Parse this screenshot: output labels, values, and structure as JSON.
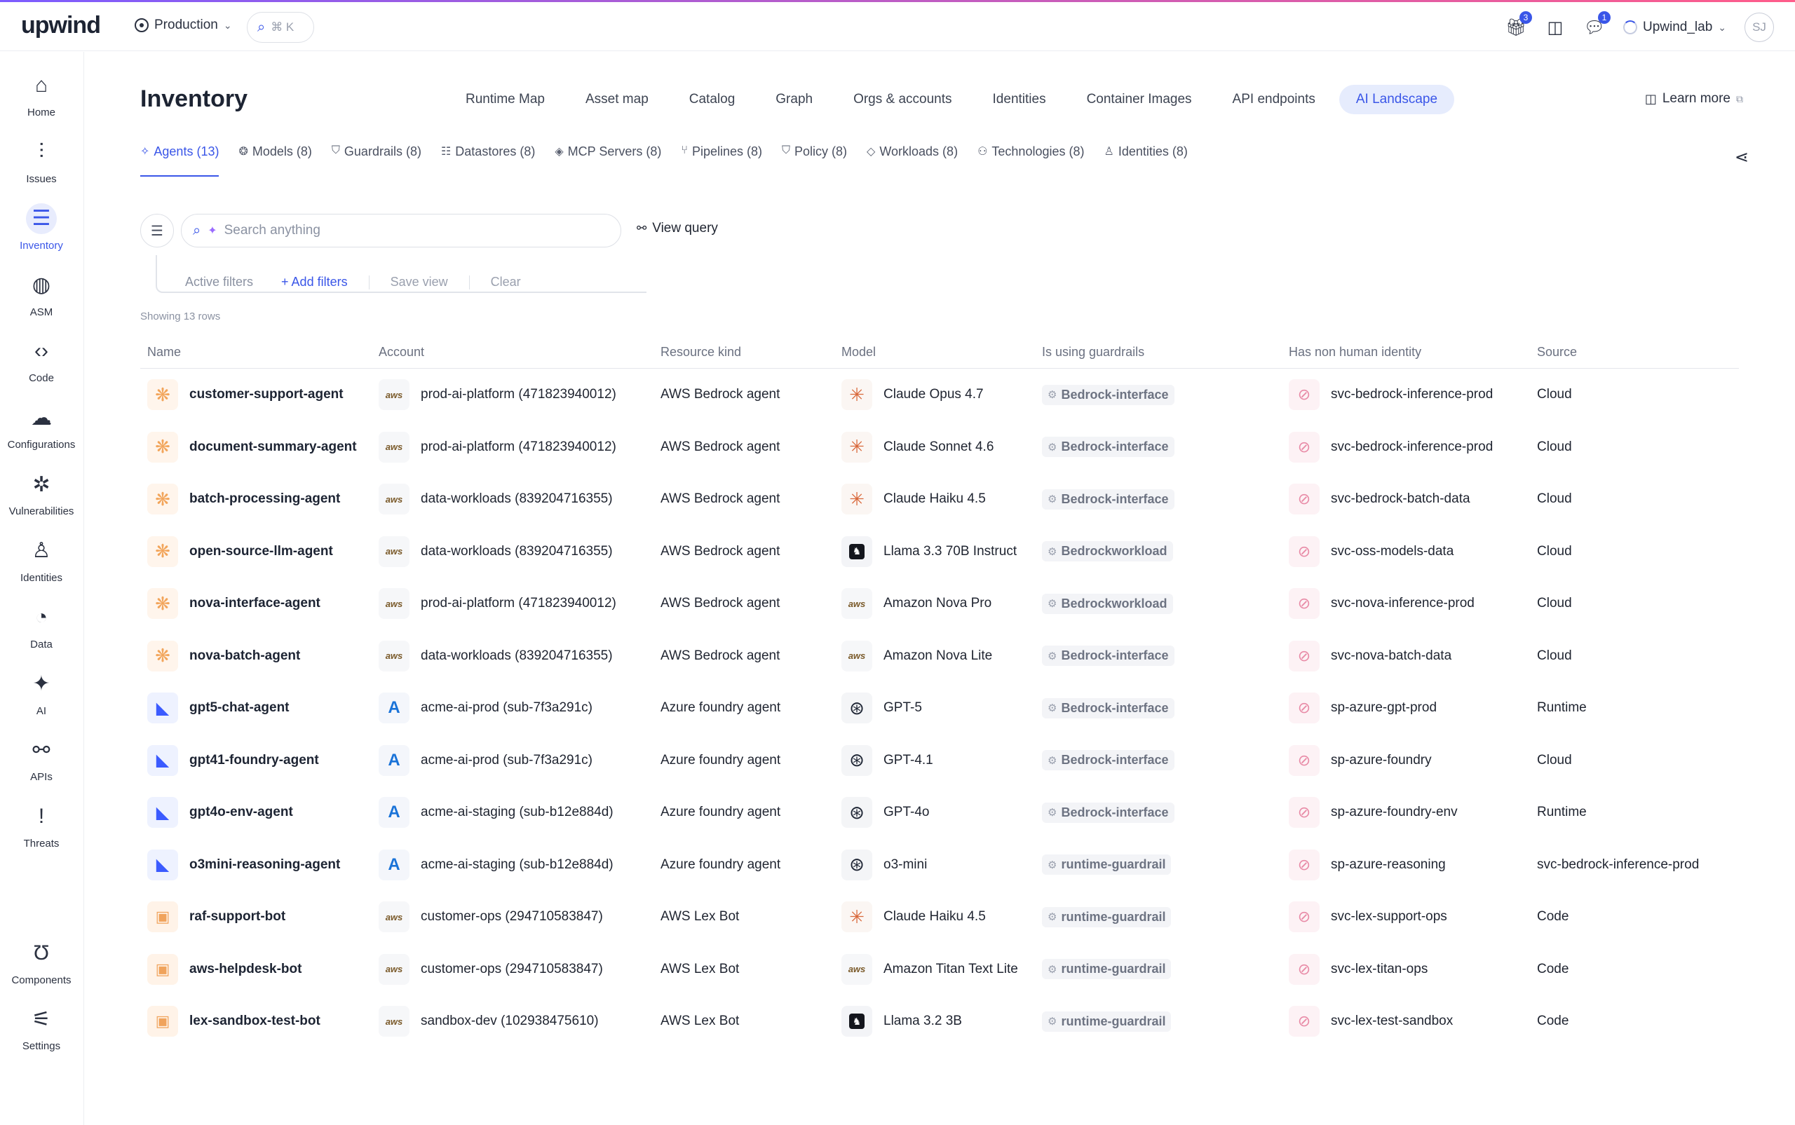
{
  "app": {
    "logo": "upwind",
    "environment": "Production",
    "command_hint": "⌘ K",
    "gift_badge": "3",
    "chat_badge": "1",
    "org_name": "Upwind_lab",
    "avatar_initials": "SJ"
  },
  "sidebar": {
    "items": [
      {
        "label": "Home",
        "icon": "home-icon",
        "glyph": "⌂"
      },
      {
        "label": "Issues",
        "icon": "issues-icon",
        "glyph": "⫶"
      },
      {
        "label": "Inventory",
        "icon": "inventory-icon",
        "glyph": "☰",
        "active": true
      },
      {
        "label": "ASM",
        "icon": "globe-icon",
        "glyph": "◍"
      },
      {
        "label": "Code",
        "icon": "code-icon",
        "glyph": "‹›"
      },
      {
        "label": "Configurations",
        "icon": "cloud-icon",
        "glyph": "☁"
      },
      {
        "label": "Vulnerabilities",
        "icon": "bug-icon",
        "glyph": "✲"
      },
      {
        "label": "Identities",
        "icon": "person-icon",
        "glyph": "♙"
      },
      {
        "label": "Data",
        "icon": "pie-chart-icon",
        "glyph": "◔"
      },
      {
        "label": "AI",
        "icon": "sparkle-icon",
        "glyph": "✦"
      },
      {
        "label": "APIs",
        "icon": "share-nodes-icon",
        "glyph": "⚯"
      },
      {
        "label": "Threats",
        "icon": "exclamation-icon",
        "glyph": "!"
      }
    ],
    "bottom_items": [
      {
        "label": "Components",
        "icon": "components-icon",
        "glyph": "Ʊ"
      },
      {
        "label": "Settings",
        "icon": "sliders-icon",
        "glyph": "⚟"
      }
    ]
  },
  "header": {
    "title": "Inventory",
    "tabs": [
      "Runtime Map",
      "Asset map",
      "Catalog",
      "Graph",
      "Orgs & accounts",
      "Identities",
      "Container Images",
      "API endpoints",
      "AI Landscape"
    ],
    "active_tab": "AI Landscape",
    "learn_more": "Learn more"
  },
  "subtabs": [
    {
      "label": "Agents (13)",
      "icon": "agents-icon",
      "glyph": "✧",
      "active": true
    },
    {
      "label": "Models (8)",
      "icon": "models-icon",
      "glyph": "❂"
    },
    {
      "label": "Guardrails (8)",
      "icon": "shield-icon",
      "glyph": "⛉"
    },
    {
      "label": "Datastores (8)",
      "icon": "database-icon",
      "glyph": "☷"
    },
    {
      "label": "MCP Servers (8)",
      "icon": "mcp-icon",
      "glyph": "◈"
    },
    {
      "label": "Pipelines (8)",
      "icon": "pipeline-icon",
      "glyph": "⑂"
    },
    {
      "label": "Policy (8)",
      "icon": "policy-icon",
      "glyph": "⛉"
    },
    {
      "label": "Workloads (8)",
      "icon": "layers-icon",
      "glyph": "◇"
    },
    {
      "label": "Technologies (8)",
      "icon": "technologies-icon",
      "glyph": "⚇"
    },
    {
      "label": "Identities (8)",
      "icon": "user-icon",
      "glyph": "♙"
    }
  ],
  "filters": {
    "search_placeholder": "Search anything",
    "view_query": "View query",
    "active_filters": "Active filters",
    "add_filters": "+ Add filters",
    "save_view": "Save view",
    "clear": "Clear",
    "showing": "Showing 13 rows"
  },
  "table": {
    "columns": [
      "Name",
      "Account",
      "Resource kind",
      "Model",
      "Is using guardrails",
      "Has non human identity",
      "Source"
    ],
    "rows": [
      {
        "name": "customer-support-agent",
        "name_icon": "bedrock",
        "account": "prod-ai-platform (471823940012)",
        "account_icon": "aws",
        "kind": "AWS Bedrock agent",
        "model": "Claude Opus 4.7",
        "model_icon": "claude",
        "guardrail": "Bedrock-interface",
        "nhi": "svc-bedrock-inference-prod",
        "source": "Cloud"
      },
      {
        "name": "document-summary-agent",
        "name_icon": "bedrock",
        "account": "prod-ai-platform (471823940012)",
        "account_icon": "aws",
        "kind": "AWS Bedrock agent",
        "model": "Claude Sonnet 4.6",
        "model_icon": "claude",
        "guardrail": "Bedrock-interface",
        "nhi": "svc-bedrock-inference-prod",
        "source": "Cloud"
      },
      {
        "name": "batch-processing-agent",
        "name_icon": "bedrock",
        "account": "data-workloads (839204716355)",
        "account_icon": "aws",
        "kind": "AWS Bedrock agent",
        "model": "Claude Haiku 4.5",
        "model_icon": "claude",
        "guardrail": "Bedrock-interface",
        "nhi": "svc-bedrock-batch-data",
        "source": "Cloud"
      },
      {
        "name": "open-source-llm-agent",
        "name_icon": "bedrock",
        "account": "data-workloads (839204716355)",
        "account_icon": "aws",
        "kind": "AWS Bedrock agent",
        "model": "Llama 3.3 70B Instruct",
        "model_icon": "llama",
        "guardrail": "Bedrockworkload",
        "nhi": "svc-oss-models-data",
        "source": "Cloud"
      },
      {
        "name": "nova-interface-agent",
        "name_icon": "bedrock",
        "account": "prod-ai-platform (471823940012)",
        "account_icon": "aws",
        "kind": "AWS Bedrock agent",
        "model": "Amazon Nova Pro",
        "model_icon": "aws",
        "guardrail": "Bedrockworkload",
        "nhi": "svc-nova-inference-prod",
        "source": "Cloud"
      },
      {
        "name": "nova-batch-agent",
        "name_icon": "bedrock",
        "account": "data-workloads (839204716355)",
        "account_icon": "aws",
        "kind": "AWS Bedrock agent",
        "model": "Amazon Nova Lite",
        "model_icon": "aws",
        "guardrail": "Bedrock-interface",
        "nhi": "svc-nova-batch-data",
        "source": "Cloud"
      },
      {
        "name": "gpt5-chat-agent",
        "name_icon": "azure-agent",
        "account": "acme-ai-prod (sub-7f3a291c)",
        "account_icon": "azure",
        "kind": "Azure foundry agent",
        "model": "GPT-5",
        "model_icon": "openai",
        "guardrail": "Bedrock-interface",
        "nhi": "sp-azure-gpt-prod",
        "source": "Runtime"
      },
      {
        "name": "gpt41-foundry-agent",
        "name_icon": "azure-agent",
        "account": "acme-ai-prod (sub-7f3a291c)",
        "account_icon": "azure",
        "kind": "Azure foundry agent",
        "model": "GPT-4.1",
        "model_icon": "openai",
        "guardrail": "Bedrock-interface",
        "nhi": "sp-azure-foundry",
        "source": "Cloud"
      },
      {
        "name": "gpt4o-env-agent",
        "name_icon": "azure-agent",
        "account": "acme-ai-staging (sub-b12e884d)",
        "account_icon": "azure",
        "kind": "Azure foundry agent",
        "model": "GPT-4o",
        "model_icon": "openai",
        "guardrail": "Bedrock-interface",
        "nhi": "sp-azure-foundry-env",
        "source": "Runtime"
      },
      {
        "name": "o3mini-reasoning-agent",
        "name_icon": "azure-agent",
        "account": "acme-ai-staging (sub-b12e884d)",
        "account_icon": "azure",
        "kind": "Azure foundry agent",
        "model": "o3-mini",
        "model_icon": "openai",
        "guardrail": "runtime-guardrail",
        "nhi": "sp-azure-reasoning",
        "source": "svc-bedrock-inference-prod"
      },
      {
        "name": "raf-support-bot",
        "name_icon": "lex",
        "account": "customer-ops (294710583847)",
        "account_icon": "aws",
        "kind": "AWS Lex Bot",
        "model": "Claude Haiku 4.5",
        "model_icon": "claude",
        "guardrail": "runtime-guardrail",
        "nhi": "svc-lex-support-ops",
        "source": "Code"
      },
      {
        "name": "aws-helpdesk-bot",
        "name_icon": "lex",
        "account": "customer-ops (294710583847)",
        "account_icon": "aws",
        "kind": "AWS Lex Bot",
        "model": "Amazon Titan Text Lite",
        "model_icon": "aws",
        "guardrail": "runtime-guardrail",
        "nhi": "svc-lex-titan-ops",
        "source": "Code"
      },
      {
        "name": "lex-sandbox-test-bot",
        "name_icon": "lex",
        "account": "sandbox-dev (102938475610)",
        "account_icon": "aws",
        "kind": "AWS Lex Bot",
        "model": "Llama 3.2 3B",
        "model_icon": "llama",
        "guardrail": "runtime-guardrail",
        "nhi": "svc-lex-test-sandbox",
        "source": "Code"
      }
    ]
  }
}
